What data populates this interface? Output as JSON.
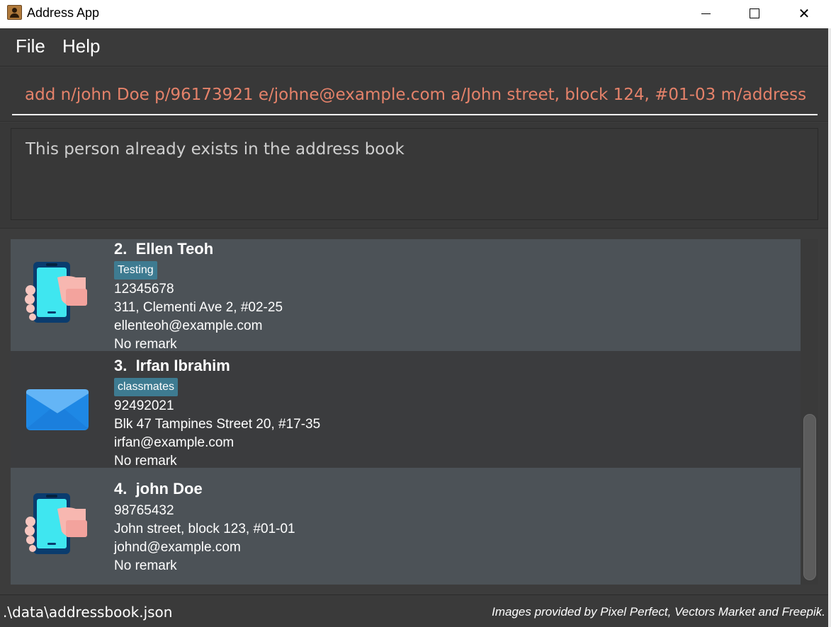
{
  "window": {
    "title": "Address App"
  },
  "menu": {
    "items": [
      {
        "label": "File"
      },
      {
        "label": "Help"
      }
    ]
  },
  "command": {
    "value": "add n/john Doe p/96173921 e/johne@example.com a/John street, block 124, #01-03 m/address"
  },
  "result": {
    "message": "This person already exists in the address book"
  },
  "persons": [
    {
      "index_name": "2.  Ellen Teoh",
      "tag": "Testing",
      "phone": "12345678",
      "address": "311, Clementi Ave 2, #02-25",
      "email": "ellenteoh@example.com",
      "remark": "No remark",
      "icon": "phone-in-hand-icon"
    },
    {
      "index_name": "3.  Irfan Ibrahim",
      "tag": "classmates",
      "phone": "92492021",
      "address": "Blk 47 Tampines Street 20, #17-35",
      "email": "irfan@example.com",
      "remark": "No remark",
      "icon": "envelope-icon"
    },
    {
      "index_name": "4.  john Doe",
      "phone": "98765432",
      "address": "John street, block 123, #01-01",
      "email": "johnd@example.com",
      "remark": "No remark",
      "icon": "phone-in-hand-icon"
    }
  ],
  "status": {
    "file_path": ".\\data\\addressbook.json",
    "credits": "Images provided by Pixel Perfect, Vectors Market and Freepik."
  },
  "colors": {
    "command_text": "#e5826a",
    "tag_background": "#3e7b91",
    "card_light": "#4c5257",
    "card_dark": "#3b3c3e"
  }
}
